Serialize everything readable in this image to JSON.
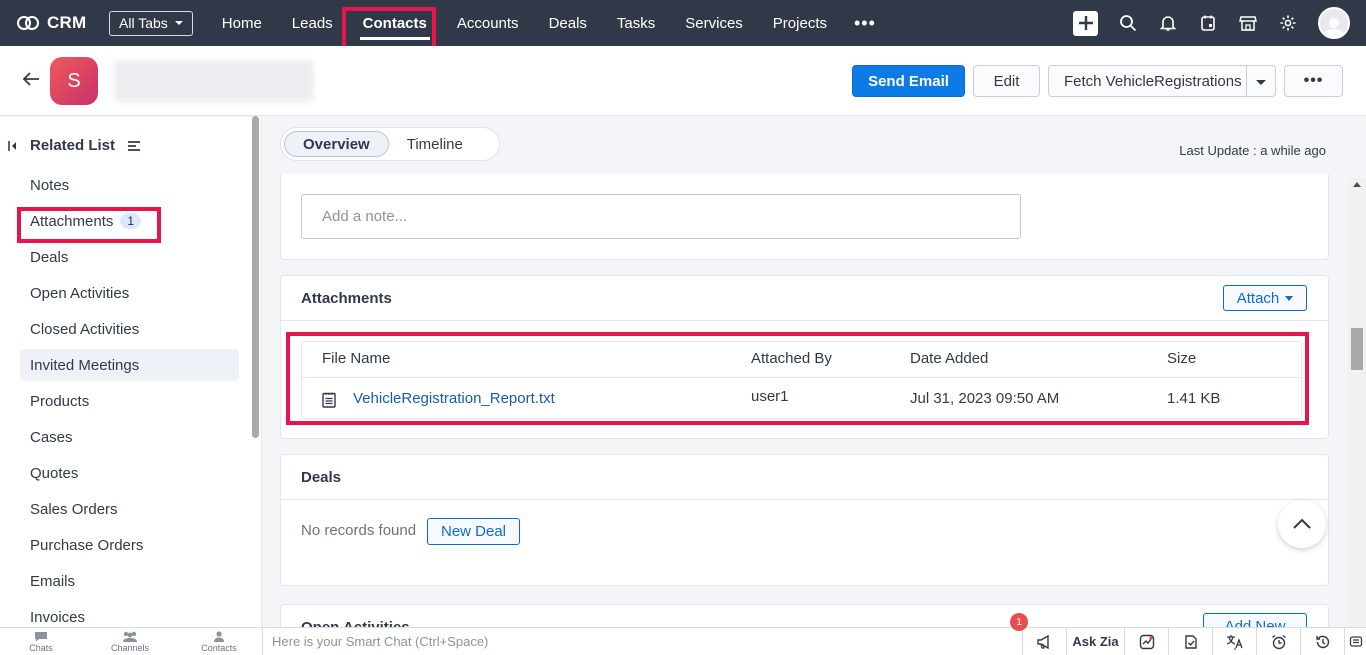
{
  "app": {
    "name": "CRM"
  },
  "topnav": {
    "all_tabs": "All Tabs",
    "tabs": [
      "Home",
      "Leads",
      "Contacts",
      "Accounts",
      "Deals",
      "Tasks",
      "Services",
      "Projects"
    ],
    "more": "•••"
  },
  "record": {
    "avatar_letter": "S"
  },
  "actions": {
    "send_email": "Send Email",
    "edit": "Edit",
    "fetch": "Fetch VehicleRegistrations",
    "more": "•••"
  },
  "sidebar": {
    "title": "Related List",
    "items": [
      {
        "label": "Notes"
      },
      {
        "label": "Attachments",
        "badge": "1"
      },
      {
        "label": "Deals"
      },
      {
        "label": "Open Activities"
      },
      {
        "label": "Closed Activities"
      },
      {
        "label": "Invited Meetings"
      },
      {
        "label": "Products"
      },
      {
        "label": "Cases"
      },
      {
        "label": "Quotes"
      },
      {
        "label": "Sales Orders"
      },
      {
        "label": "Purchase Orders"
      },
      {
        "label": "Emails"
      },
      {
        "label": "Invoices"
      }
    ]
  },
  "view_tabs": {
    "overview": "Overview",
    "timeline": "Timeline"
  },
  "last_update": "Last Update : a while ago",
  "notes": {
    "placeholder": "Add a note..."
  },
  "attachments": {
    "title": "Attachments",
    "attach_button": "Attach",
    "columns": [
      "File Name",
      "Attached By",
      "Date Added",
      "Size"
    ],
    "rows": [
      {
        "file_name": "VehicleRegistration_Report.txt",
        "attached_by": "user1",
        "date_added": "Jul 31, 2023 09:50 AM",
        "size": "1.41 KB"
      }
    ]
  },
  "deals": {
    "title": "Deals",
    "empty": "No records found",
    "new_button": "New Deal"
  },
  "open_activities": {
    "title": "Open Activities",
    "add_button": "Add New"
  },
  "bottombar": {
    "chats": "Chats",
    "channels": "Channels",
    "contacts": "Contacts",
    "smart_chat": "Here is your Smart Chat (Ctrl+Space)",
    "ask_zia": "Ask Zia",
    "notification_count": "1"
  },
  "colors": {
    "nav_bg": "#313949",
    "primary": "#0d7ae5",
    "highlight": "#e8144c"
  }
}
